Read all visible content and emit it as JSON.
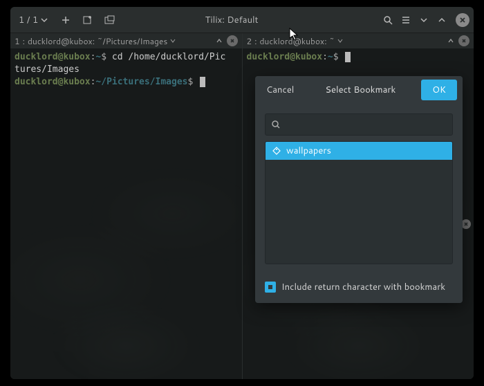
{
  "header": {
    "session_count": "1 / 1",
    "title": "Tilix: Default"
  },
  "panes": {
    "left": {
      "tab_index": "1",
      "tab_title": "ducklord@kubox: ~/Pictures/Images",
      "line1_user": "ducklord",
      "line1_at": "@",
      "line1_host": "kubox",
      "line1_sep": ":",
      "line1_tilde": "~",
      "line1_prompt": "$",
      "line1_cmd": "cd /home/ducklord/Pic",
      "line2_cmd": "tures/Images",
      "line3_user": "ducklord",
      "line3_at": "@",
      "line3_host": "kubox",
      "line3_sep": ":",
      "line3_path": "~/Pictures/Images",
      "line3_prompt": "$"
    },
    "right": {
      "tab_index": "2",
      "tab_title": "ducklord@kubox: ~",
      "line1_user": "ducklord",
      "line1_at": "@",
      "line1_host": "kubox",
      "line1_sep": ":",
      "line1_path": "~",
      "line1_prompt": "$"
    }
  },
  "dialog": {
    "cancel": "Cancel",
    "title": "Select Bookmark",
    "ok": "OK",
    "search_placeholder": "",
    "bookmarks": [
      {
        "label": "wallpapers"
      }
    ],
    "include_return": "Include return character with bookmark",
    "include_return_checked": true
  }
}
